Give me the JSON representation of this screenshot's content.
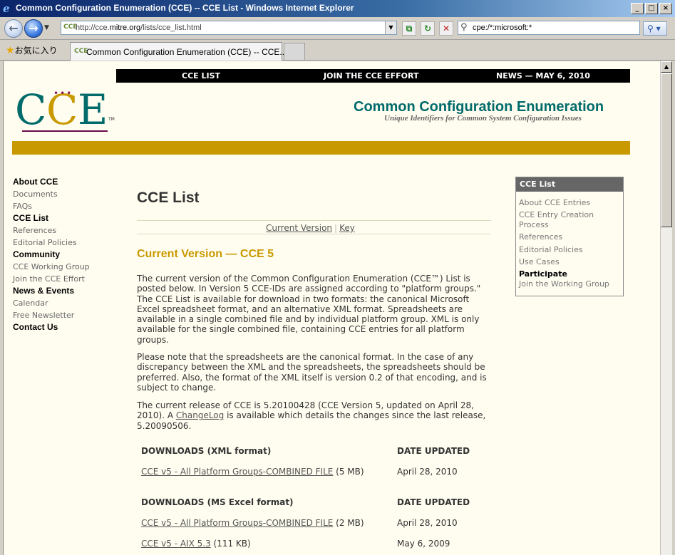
{
  "window": {
    "title": "Common Configuration Enumeration (CCE) -- CCE List - Windows Internet Explorer",
    "controls": [
      "_",
      "□",
      "×"
    ]
  },
  "navbar": {
    "back_glyph": "←",
    "forward_glyph": "→",
    "dropdown_glyph": "▼",
    "address": {
      "favicon": "CCE",
      "url_prefix": "http://cce.",
      "url_domain": "mitre.org",
      "url_path": "/lists/cce_list.html"
    },
    "compat_glyph": "⧉",
    "refresh_glyph": "↻",
    "stop_glyph": "✕",
    "search": {
      "value": "cpe:/*:microsoft:*",
      "go_glyph": "⚲ ▾"
    }
  },
  "tabbar": {
    "favorites_label": "お気に入り",
    "tab_label": "Common Configuration Enumeration (CCE) -- CCE...",
    "tab_favicon": "CCE"
  },
  "site": {
    "topnav": [
      "CCE LIST",
      "JOIN THE CCE EFFORT",
      "NEWS — MAY 6, 2010"
    ],
    "logo": {
      "tm": "TM"
    },
    "title": "Common Configuration Enumeration",
    "subtitle": "Unique Identifiers for Common System Configuration Issues"
  },
  "leftnav": {
    "about": "About CCE",
    "documents": "Documents",
    "faqs": "FAQs",
    "cce_list": "CCE List",
    "references": "References",
    "editorial": "Editorial Policies",
    "community": "Community",
    "working_group": "CCE Working Group",
    "join": "Join the CCE Effort",
    "news": "News & Events",
    "calendar": "Calendar",
    "newsletter": "Free Newsletter",
    "contact": "Contact Us"
  },
  "main": {
    "title": "CCE List",
    "jump_current": "Current Version",
    "jump_sep": "|",
    "jump_key": "Key",
    "section_heading": "Current Version — CCE 5",
    "para1": "The current version of the Common Configuration Enumeration (CCE™) List is posted below. In Version 5 CCE-IDs are assigned according to \"platform groups.\" The CCE List is available for download in two formats: the canonical Microsoft Excel spreadsheet format, and an alternative XML format. Spreadsheets are available in a single combined file and by individual platform group. XML is only available for the single combined file, containing CCE entries for all platform groups.",
    "para2": "Please note that the spreadsheets are the canonical format. In the case of any discrepancy between the XML and the spreadsheets, the spreadsheets should be preferred. Also, the format of the XML itself is version 0.2 of that encoding, and is subject to change.",
    "para3_a": "The current release of CCE is 5.20100428 (CCE Version 5, updated on April 28, 2010). A ",
    "para3_link": "ChangeLog",
    "para3_b": " is available which details the changes since the last release, 5.20090506.",
    "xml_heading": "DOWNLOADS (XML format)",
    "xls_heading": "DOWNLOADS (MS Excel format)",
    "date_heading": "DATE UPDATED",
    "xml_rows": [
      {
        "link": "CCE v5 - All Platform Groups-COMBINED FILE",
        "size": " (5 MB)",
        "date": "April 28, 2010"
      }
    ],
    "xls_rows": [
      {
        "link": "CCE v5 - All Platform Groups-COMBINED FILE",
        "size": " (2 MB)",
        "date": "April 28, 2010"
      },
      {
        "link": "CCE v5 - AIX 5.3",
        "size": " (111 KB)",
        "date": "May 6, 2009"
      }
    ]
  },
  "rightbox": {
    "header": "CCE List",
    "about": "About CCE Entries",
    "creation": "CCE Entry Creation Process",
    "references": "References",
    "editorial": "Editorial Policies",
    "use_cases": "Use Cases",
    "participate": "Participate",
    "join_wg": "Join the Working Group"
  },
  "colors": {
    "teal": "#006b6b",
    "gold": "#c89900",
    "page_bg": "#fffdf0"
  }
}
